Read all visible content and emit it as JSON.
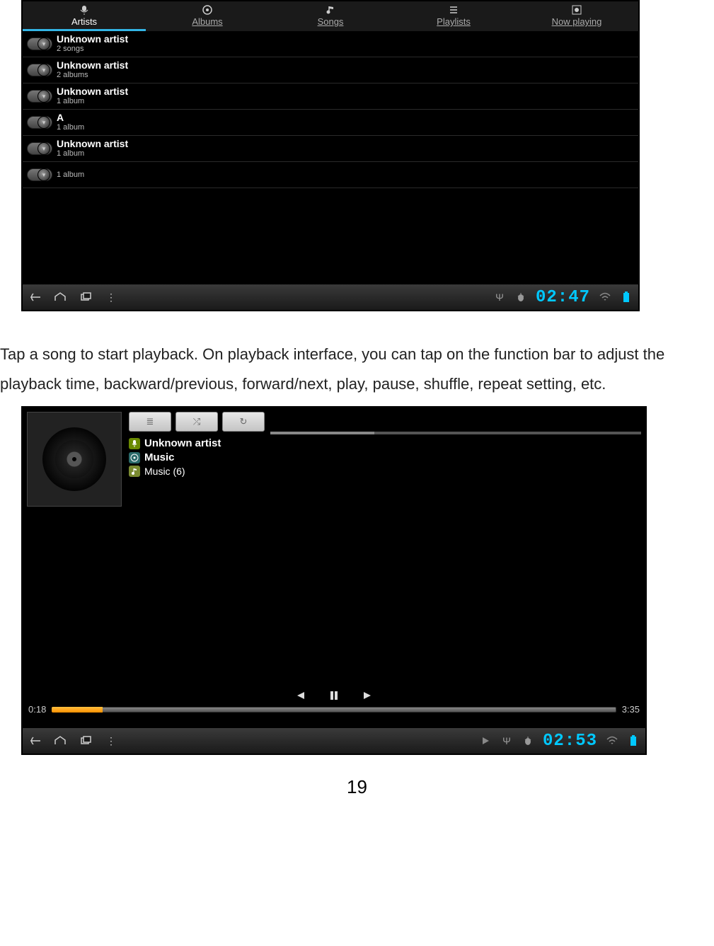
{
  "paragraph": "Tap a song to start playback.   On playback interface, you can tap on the function bar to adjust the playback time, backward/previous, forward/next, play, pause, shuffle, repeat setting, etc.",
  "page_number": "19",
  "screenshot1": {
    "tabs": [
      {
        "label": "Artists",
        "active": true
      },
      {
        "label": "Albums",
        "active": false
      },
      {
        "label": "Songs",
        "active": false
      },
      {
        "label": "Playlists",
        "active": false
      },
      {
        "label": "Now playing",
        "active": false
      }
    ],
    "artists": [
      {
        "name": "Unknown artist",
        "sub": "2 songs"
      },
      {
        "name": "Unknown artist",
        "sub": "2 albums"
      },
      {
        "name": "Unknown artist",
        "sub": "1 album"
      },
      {
        "name": "A",
        "sub": "1 album"
      },
      {
        "name": "Unknown artist",
        "sub": "1 album"
      },
      {
        "name": "",
        "sub": "1 album"
      }
    ],
    "status": {
      "time": "02:47"
    }
  },
  "screenshot2": {
    "buttons": {
      "queue": "≣",
      "shuffle": "⤮",
      "repeat": "↻"
    },
    "meta": {
      "artist": "Unknown artist",
      "album": "Music",
      "track": "Music (6)"
    },
    "playback": {
      "elapsed": "0:18",
      "total": "3:35",
      "progress_pct": 9
    },
    "status": {
      "time": "02:53"
    }
  }
}
